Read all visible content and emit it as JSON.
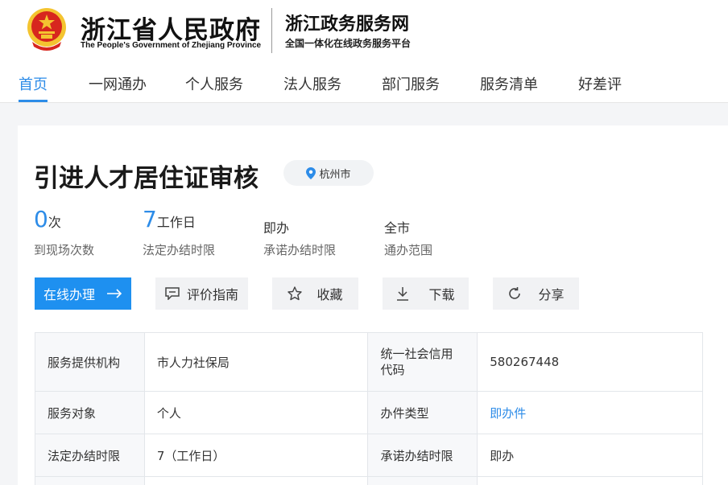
{
  "header": {
    "gov_title": "浙江省人民政府",
    "gov_subtitle": "The People's Government of Zhejiang Province",
    "portal_title": "浙江政务服务网",
    "portal_subtitle": "全国一体化在线政务服务平台"
  },
  "nav": {
    "items": [
      "首页",
      "一网通办",
      "个人服务",
      "法人服务",
      "部门服务",
      "服务清单",
      "好差评"
    ],
    "active": "首页"
  },
  "item": {
    "title": "引进人才居住证审核",
    "location": "杭州市"
  },
  "stats": [
    {
      "value": "0",
      "unit": "次",
      "caption": "到现场次数"
    },
    {
      "value": "7",
      "unit": "工作日",
      "caption": "法定办结时限"
    },
    {
      "value": "即办",
      "caption": "承诺办结时限"
    },
    {
      "value": "全市",
      "caption": "通办范围"
    }
  ],
  "actions": {
    "online": "在线办理",
    "evaluate": "评价指南",
    "favorite": "收藏",
    "download": "下载",
    "share": "分享"
  },
  "table": {
    "rows": [
      {
        "k1": "服务提供机构",
        "v1": "市人力社保局",
        "k2": "统一社会信用代码",
        "v2": "580267448"
      },
      {
        "k1": "服务对象",
        "v1": "个人",
        "k2": "办件类型",
        "v2": "即办件"
      },
      {
        "k1": "法定办结时限",
        "v1": "7（工作日）",
        "k2": "承诺办结时限",
        "v2": "即办"
      }
    ]
  },
  "colors": {
    "accent": "#2d8ce8",
    "primary_button": "#1e90f0",
    "emblem_red": "#d7261e",
    "emblem_gold": "#f4c430"
  }
}
